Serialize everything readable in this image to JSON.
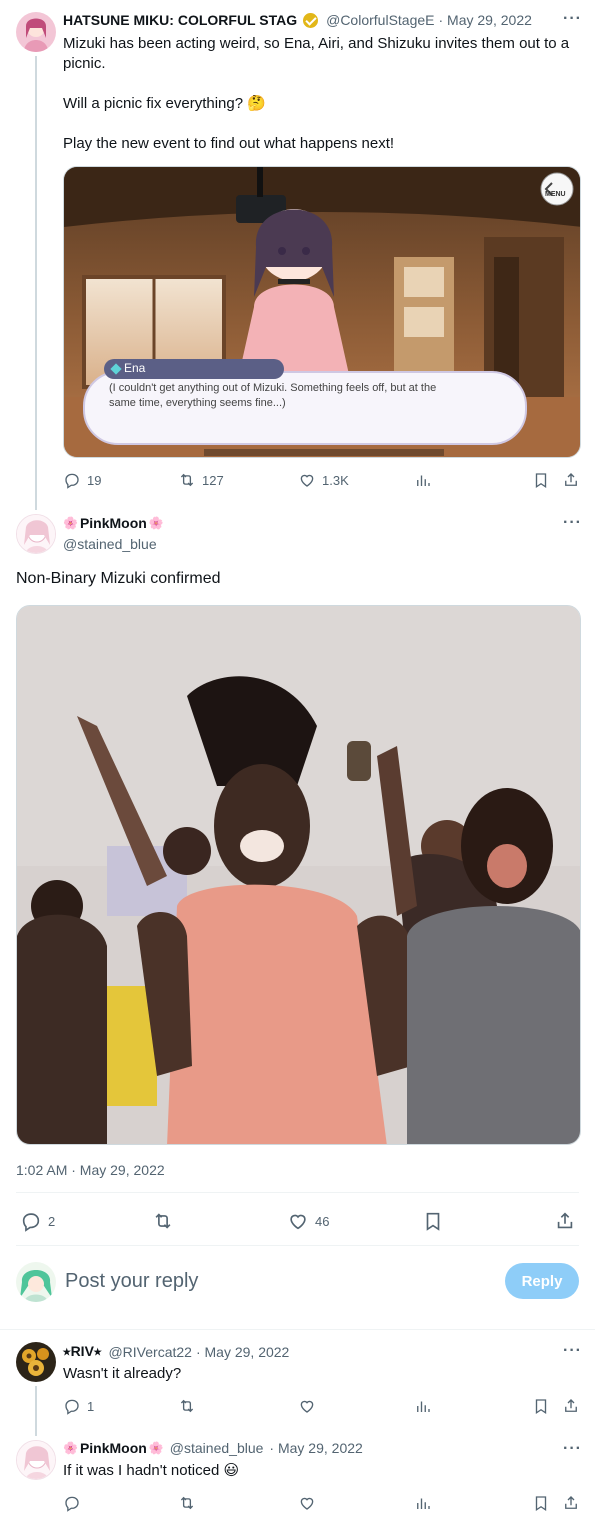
{
  "tweet1": {
    "name": "HATSUNE MIKU: COLORFUL STAG",
    "handle": "@ColorfulStageE",
    "date": "· May 29, 2022",
    "text_line1": "Mizuki has been acting weird, so Ena, Airi, and Shizuku invites them out to a",
    "text_line2": "picnic.",
    "text_line3": "Will a picnic fix everything? 🤔",
    "text_line4": "Play the new event to find out what happens next!",
    "media": {
      "menu_label": "MENU",
      "speaker": "Ena",
      "dialogue_line1": "(I couldn't get anything out of Mizuki. Something feels off, but at the",
      "dialogue_line2": "same time, everything seems fine...)"
    },
    "replies": "19",
    "retweets": "127",
    "likes": "1.3K"
  },
  "tweet2": {
    "name": "PinkMoon",
    "handle": "@stained_blue",
    "text": "Non-Binary Mizuki confirmed",
    "timestamp": "1:02 AM · May 29, 2022",
    "replies": "2",
    "likes": "46"
  },
  "reply_box": {
    "placeholder": "Post your reply",
    "button": "Reply"
  },
  "reply1": {
    "name": "RIV",
    "handle": "@RIVercat22",
    "date": "· May 29, 2022",
    "text": "Wasn't it already?",
    "replies": "1"
  },
  "reply2": {
    "name": "PinkMoon",
    "handle": "@stained_blue",
    "date": "· May 29, 2022",
    "text": "If it was I hadn't noticed 😃"
  },
  "colors": {
    "accent": "#1d9bf0",
    "reply_button": "#8ecdf8",
    "muted": "#536471"
  }
}
